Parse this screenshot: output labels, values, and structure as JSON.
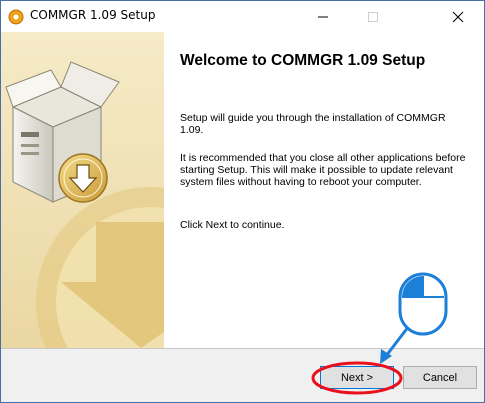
{
  "window": {
    "title": "COMMGR 1.09 Setup"
  },
  "main": {
    "heading": "Welcome to COMMGR 1.09 Setup",
    "paragraphs": [
      "Setup will guide you through the installation of COMMGR 1.09.",
      "It is recommended that you close all other applications before starting Setup. This will make it possible to update relevant system files without having to reboot your computer.",
      "Click Next to continue."
    ]
  },
  "footer": {
    "next_label": "Next >",
    "cancel_label": "Cancel"
  },
  "colors": {
    "annotation_red": "#e8111d",
    "annotation_blue": "#1c7fd8",
    "sidebar_gold": "#d8b65a"
  },
  "icons": {
    "app": "installer-disc-icon",
    "sidebar_art": "box-with-down-arrow-illustration",
    "annotation": "mouse-left-click-icon"
  }
}
